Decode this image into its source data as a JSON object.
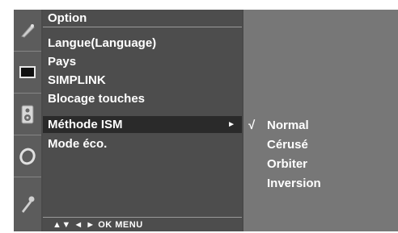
{
  "icons": [
    "picture-icon",
    "screen-icon",
    "speaker-icon",
    "clock-icon",
    "key-icon"
  ],
  "menu": {
    "title": "Option",
    "items": [
      {
        "label": "Langue(Language)"
      },
      {
        "label": "Pays"
      },
      {
        "label": "SIMPLINK"
      },
      {
        "label": "Blocage touches"
      },
      {
        "label": "Méthode ISM",
        "selected": true,
        "arrow": "►"
      },
      {
        "label": "Mode éco."
      }
    ],
    "nav_hint": "▲▼  ◄ ►  OK  MENU"
  },
  "submenu": {
    "check_mark": "√",
    "items": [
      {
        "label": "Normal",
        "checked": true
      },
      {
        "label": "Cérusé"
      },
      {
        "label": "Orbiter"
      },
      {
        "label": "Inversion"
      }
    ]
  },
  "colors": {
    "panel": "#4d4d4d",
    "icon_column": "#5c5c5c",
    "selected_row": "#2a2a2a",
    "submenu_panel": "#777777",
    "text": "#ffffff"
  }
}
